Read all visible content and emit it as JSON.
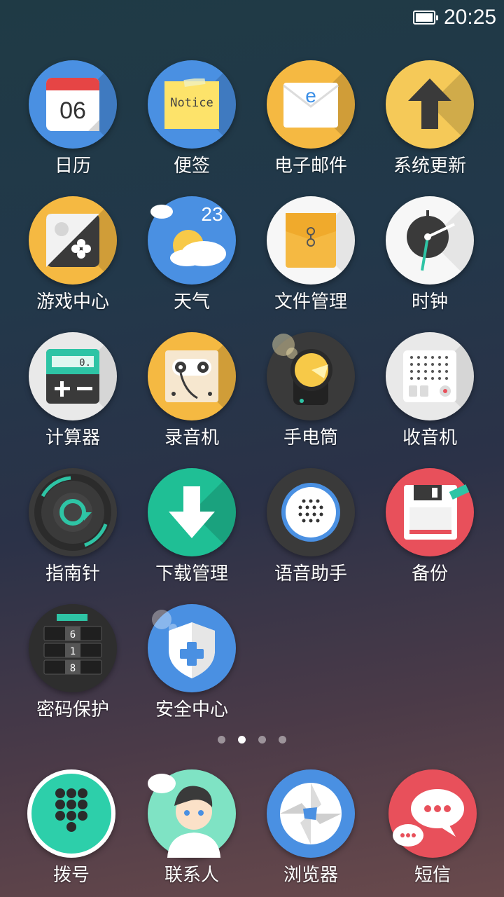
{
  "status": {
    "time": "20:25",
    "battery_icon": "battery-full-icon"
  },
  "apps": [
    {
      "label": "日历",
      "icon": "calendar-icon",
      "bg": "#4a90e2",
      "extra": "06"
    },
    {
      "label": "便签",
      "icon": "note-icon",
      "bg": "#4a90e2",
      "extra": "Notice"
    },
    {
      "label": "电子邮件",
      "icon": "email-icon",
      "bg": "#f5b942",
      "extra": "e"
    },
    {
      "label": "系统更新",
      "icon": "update-arrow-icon",
      "bg": "#f5b942"
    },
    {
      "label": "游戏中心",
      "icon": "gamepad-icon",
      "bg": "#f5b942"
    },
    {
      "label": "天气",
      "icon": "weather-icon",
      "bg": "#4a90e2",
      "extra": "23"
    },
    {
      "label": "文件管理",
      "icon": "folder-icon",
      "bg": "#f5f5f5"
    },
    {
      "label": "时钟",
      "icon": "clock-icon",
      "bg": "#f5f5f5"
    },
    {
      "label": "计算器",
      "icon": "calculator-icon",
      "bg": "#e8e8e8",
      "extra": "0."
    },
    {
      "label": "录音机",
      "icon": "cassette-icon",
      "bg": "#f5b942"
    },
    {
      "label": "手电筒",
      "icon": "flashlight-icon",
      "bg": "#3a3a3a"
    },
    {
      "label": "收音机",
      "icon": "radio-icon",
      "bg": "#e8e8e8"
    },
    {
      "label": "指南针",
      "icon": "compass-icon",
      "bg": "#3a3a3a"
    },
    {
      "label": "下载管理",
      "icon": "download-icon",
      "bg": "#1fbf95"
    },
    {
      "label": "语音助手",
      "icon": "voice-assistant-icon",
      "bg": "#3a3a3a"
    },
    {
      "label": "备份",
      "icon": "floppy-icon",
      "bg": "#e8505b"
    },
    {
      "label": "密码保护",
      "icon": "lock-dial-icon",
      "bg": "#2e2e2e",
      "extra": [
        "6",
        "1",
        "8"
      ]
    },
    {
      "label": "安全中心",
      "icon": "shield-icon",
      "bg": "#4a90e2"
    }
  ],
  "pager": {
    "count": 4,
    "active": 1
  },
  "dock": [
    {
      "label": "拨号",
      "icon": "dialpad-icon",
      "bg": "#2dcfaa"
    },
    {
      "label": "联系人",
      "icon": "contacts-icon",
      "bg": "#7fe3c4"
    },
    {
      "label": "浏览器",
      "icon": "browser-icon",
      "bg": "#4a90e2"
    },
    {
      "label": "短信",
      "icon": "sms-icon",
      "bg": "#e8505b"
    }
  ]
}
